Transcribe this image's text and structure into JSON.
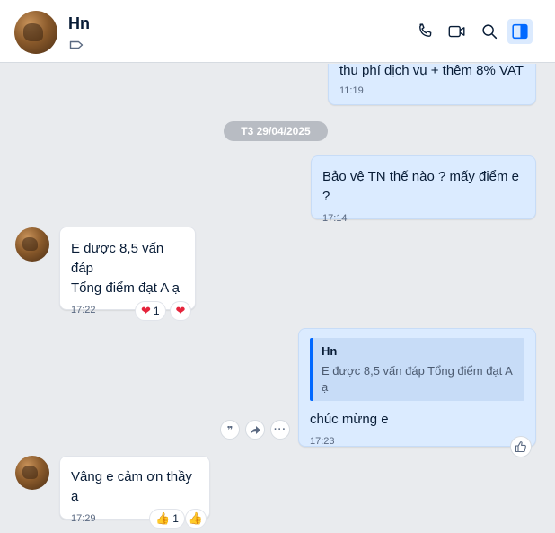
{
  "header": {
    "contact_name": "Hn",
    "icons": [
      "tag-icon",
      "phone-icon",
      "video-call-icon",
      "search-icon",
      "sidebar-toggle-icon"
    ],
    "accent_color": "#0068ff"
  },
  "messages": {
    "m0": {
      "text": "thu phí dịch vụ + thêm 8% VAT",
      "time": "11:19"
    },
    "date_separator": "T3 29/04/2025",
    "m1": {
      "text": "Bảo vệ TN thế nào ? mấy điểm e ?",
      "time": "17:14"
    },
    "m2": {
      "line1": "E được 8,5 vấn đáp",
      "line2": "Tổng điểm đạt A ạ",
      "time": "17:22",
      "reaction_count": "1"
    },
    "m3": {
      "quote_name": "Hn",
      "quote_text": "E được 8,5 vấn đáp Tổng điểm đạt A ạ",
      "text": "chúc mừng e",
      "time": "17:23"
    },
    "m4": {
      "text": "Vâng e cảm ơn thầy ạ",
      "time": "17:29",
      "reaction_count": "1"
    }
  },
  "colors": {
    "out_bubble": "#dbebff",
    "in_bubble": "#ffffff",
    "background": "#e9ebee"
  }
}
